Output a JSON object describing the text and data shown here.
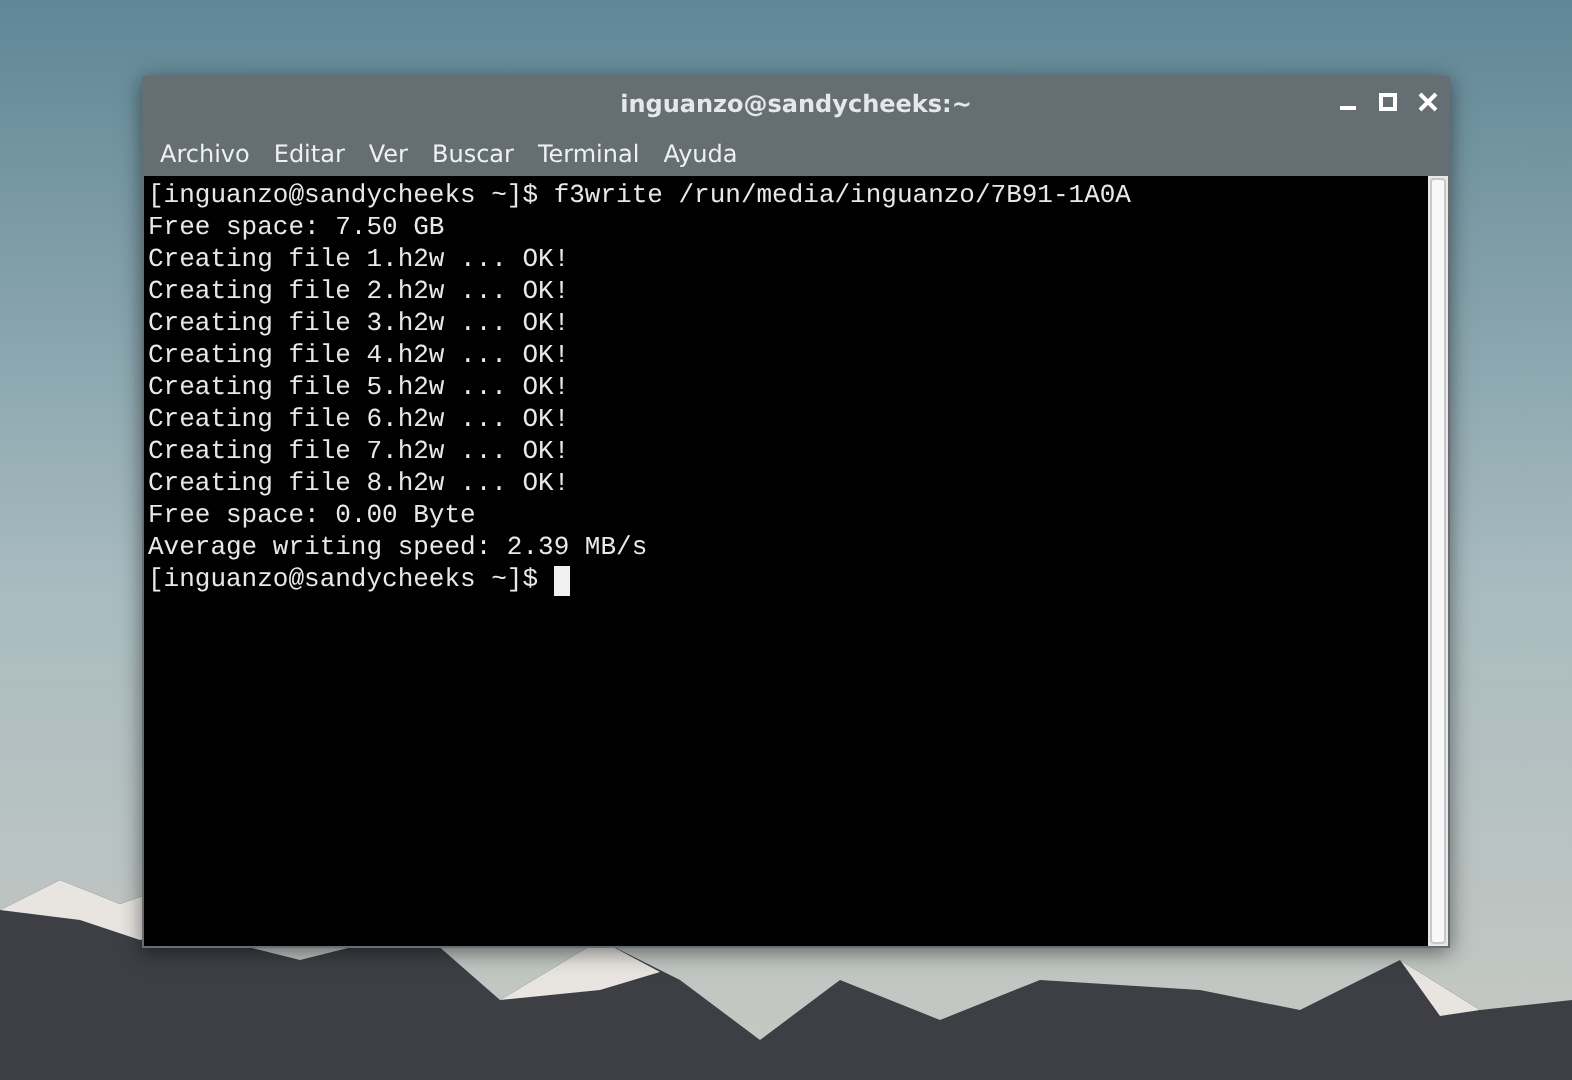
{
  "window": {
    "title": "inguanzo@sandycheeks:~"
  },
  "menu": [
    "Archivo",
    "Editar",
    "Ver",
    "Buscar",
    "Terminal",
    "Ayuda"
  ],
  "terminal": {
    "lines": [
      {
        "text": "[inguanzo@sandycheeks ~]$ f3write /run/media/inguanzo/7B91-1A0A",
        "cursor": false
      },
      {
        "text": "Free space: 7.50 GB",
        "cursor": false
      },
      {
        "text": "Creating file 1.h2w ... OK!",
        "cursor": false
      },
      {
        "text": "Creating file 2.h2w ... OK!",
        "cursor": false
      },
      {
        "text": "Creating file 3.h2w ... OK!",
        "cursor": false
      },
      {
        "text": "Creating file 4.h2w ... OK!",
        "cursor": false
      },
      {
        "text": "Creating file 5.h2w ... OK!",
        "cursor": false
      },
      {
        "text": "Creating file 6.h2w ... OK!",
        "cursor": false
      },
      {
        "text": "Creating file 7.h2w ... OK!",
        "cursor": false
      },
      {
        "text": "Creating file 8.h2w ... OK!",
        "cursor": false
      },
      {
        "text": "Free space: 0.00 Byte",
        "cursor": false
      },
      {
        "text": "Average writing speed: 2.39 MB/s",
        "cursor": false
      },
      {
        "text": "[inguanzo@sandycheeks ~]$",
        "cursor": true
      }
    ]
  }
}
